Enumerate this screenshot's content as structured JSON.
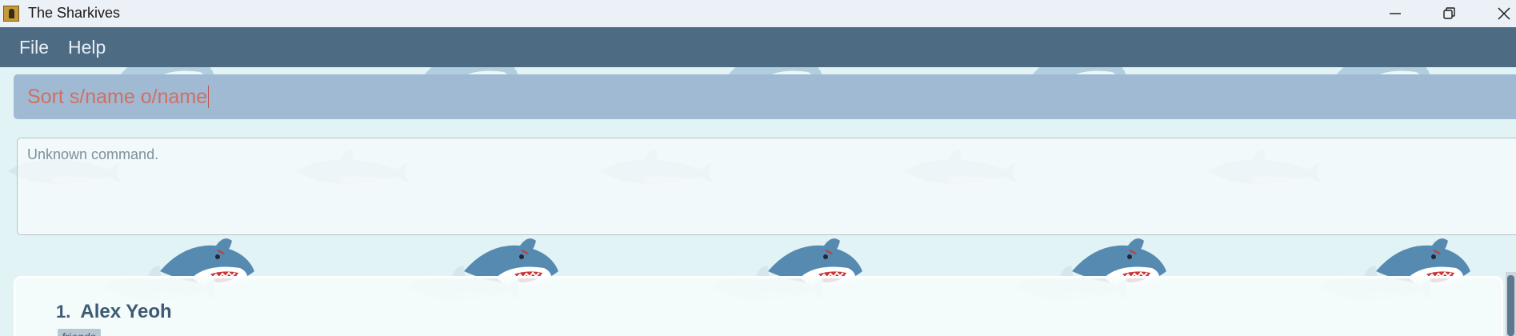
{
  "window": {
    "title": "The Sharkives"
  },
  "menu": {
    "items": [
      {
        "label": "File"
      },
      {
        "label": "Help"
      }
    ]
  },
  "command_box": {
    "value": "Sort s/name o/name",
    "text_color": "#d06f64",
    "background": "#9fbad2"
  },
  "result_display": {
    "message": "Unknown command."
  },
  "person_list": {
    "persons": [
      {
        "index": "1.",
        "name": "Alex Yeoh",
        "tags": [
          "friends"
        ]
      }
    ]
  },
  "colors": {
    "menu_bar": "#4e6b84",
    "name_text": "#3d5a74",
    "title_bar": "#ecf0f7"
  },
  "icons": {
    "app": "shark-archive-app-icon",
    "minimize": "minimize-icon",
    "maximize": "restore-icon",
    "close": "close-icon",
    "wallpaper": "shark-pattern"
  }
}
